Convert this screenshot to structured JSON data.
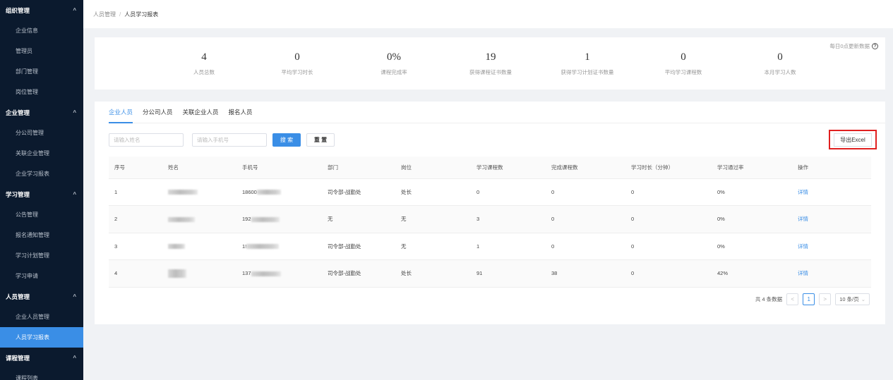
{
  "sidebar": {
    "groups": [
      {
        "label": "组织管理",
        "items": [
          "企业信息",
          "管理员",
          "部门管理",
          "岗位管理"
        ]
      },
      {
        "label": "企业管理",
        "items": [
          "分公司管理",
          "关联企业管理",
          "企业学习报表"
        ]
      },
      {
        "label": "学习管理",
        "items": [
          "公告管理",
          "报名通知管理",
          "学习计划管理",
          "学习申请"
        ]
      },
      {
        "label": "人员管理",
        "items": [
          "企业人员管理",
          "人员学习报表"
        ]
      },
      {
        "label": "课程管理",
        "items": [
          "课程列表"
        ]
      }
    ],
    "caret": "^",
    "active_item": "人员学习报表"
  },
  "breadcrumb": {
    "parent": "人员管理",
    "separator": "/",
    "current": "人员学习报表"
  },
  "stats": {
    "note": "每日0点更新数据",
    "items": [
      {
        "value": "4",
        "label": "人员总数"
      },
      {
        "value": "0",
        "label": "平均学习时长"
      },
      {
        "value": "0%",
        "label": "课程完成率"
      },
      {
        "value": "19",
        "label": "获得课程证书数量"
      },
      {
        "value": "1",
        "label": "获得学习计划证书数量"
      },
      {
        "value": "0",
        "label": "平均学习课程数"
      },
      {
        "value": "0",
        "label": "本月学习人数"
      }
    ]
  },
  "tabs": [
    "企业人员",
    "分公司人员",
    "关联企业人员",
    "报名人员"
  ],
  "search": {
    "name_placeholder": "请输入姓名",
    "phone_placeholder": "请输入手机号",
    "search_label": "搜 索",
    "reset_label": "重 置",
    "export_label": "导出Excel"
  },
  "table": {
    "columns": [
      "序号",
      "姓名",
      "手机号",
      "部门",
      "岗位",
      "学习课程数",
      "完成课程数",
      "学习时长（分钟）",
      "学习通过率",
      "操作"
    ],
    "rows": [
      {
        "no": "1",
        "phone": "18600",
        "dept": "司令部-战勤处",
        "post": "处长",
        "courses": "0",
        "done": "0",
        "duration": "0",
        "rate": "0%",
        "action": "详情"
      },
      {
        "no": "2",
        "phone": "192",
        "dept": "无",
        "post": "无",
        "courses": "3",
        "done": "0",
        "duration": "0",
        "rate": "0%",
        "action": "详情"
      },
      {
        "no": "3",
        "phone": "1!",
        "dept": "司令部-战勤处",
        "post": "无",
        "courses": "1",
        "done": "0",
        "duration": "0",
        "rate": "0%",
        "action": "详情"
      },
      {
        "no": "4",
        "phone": "137",
        "dept": "司令部-战勤处",
        "post": "处长",
        "courses": "91",
        "done": "38",
        "duration": "0",
        "rate": "42%",
        "action": "详情"
      }
    ]
  },
  "pagination": {
    "total_text": "共 4 条数据",
    "prev": "<",
    "page": "1",
    "next": ">",
    "page_size": "10 条/页"
  }
}
